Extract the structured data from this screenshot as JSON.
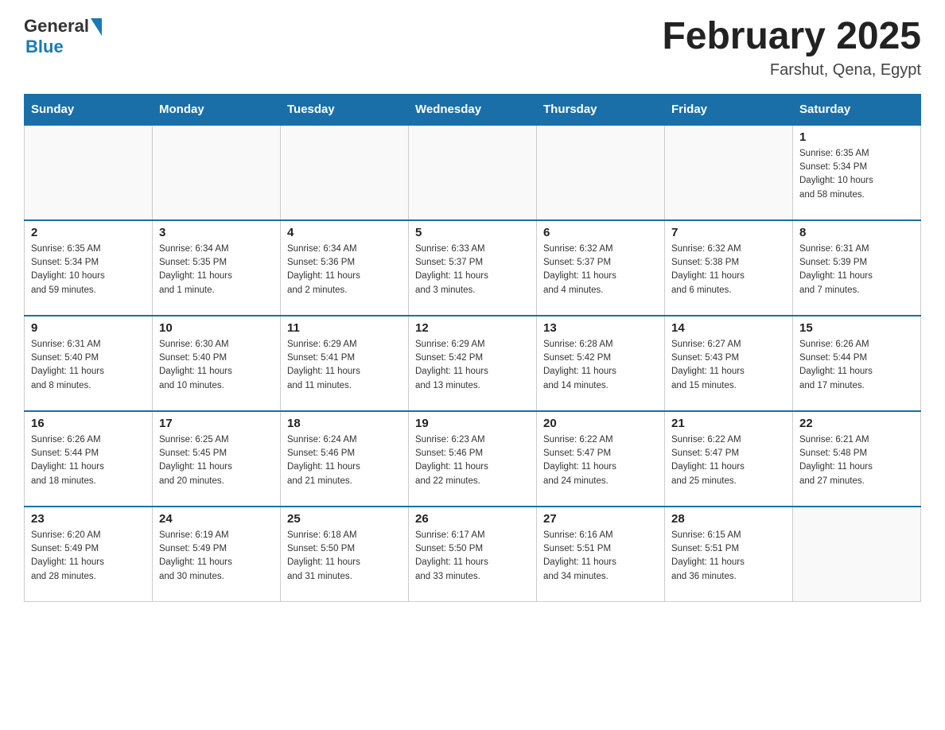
{
  "header": {
    "logo": {
      "general": "General",
      "blue": "Blue"
    },
    "title": "February 2025",
    "location": "Farshut, Qena, Egypt"
  },
  "weekdays": [
    "Sunday",
    "Monday",
    "Tuesday",
    "Wednesday",
    "Thursday",
    "Friday",
    "Saturday"
  ],
  "weeks": [
    [
      {
        "day": "",
        "info": ""
      },
      {
        "day": "",
        "info": ""
      },
      {
        "day": "",
        "info": ""
      },
      {
        "day": "",
        "info": ""
      },
      {
        "day": "",
        "info": ""
      },
      {
        "day": "",
        "info": ""
      },
      {
        "day": "1",
        "info": "Sunrise: 6:35 AM\nSunset: 5:34 PM\nDaylight: 10 hours\nand 58 minutes."
      }
    ],
    [
      {
        "day": "2",
        "info": "Sunrise: 6:35 AM\nSunset: 5:34 PM\nDaylight: 10 hours\nand 59 minutes."
      },
      {
        "day": "3",
        "info": "Sunrise: 6:34 AM\nSunset: 5:35 PM\nDaylight: 11 hours\nand 1 minute."
      },
      {
        "day": "4",
        "info": "Sunrise: 6:34 AM\nSunset: 5:36 PM\nDaylight: 11 hours\nand 2 minutes."
      },
      {
        "day": "5",
        "info": "Sunrise: 6:33 AM\nSunset: 5:37 PM\nDaylight: 11 hours\nand 3 minutes."
      },
      {
        "day": "6",
        "info": "Sunrise: 6:32 AM\nSunset: 5:37 PM\nDaylight: 11 hours\nand 4 minutes."
      },
      {
        "day": "7",
        "info": "Sunrise: 6:32 AM\nSunset: 5:38 PM\nDaylight: 11 hours\nand 6 minutes."
      },
      {
        "day": "8",
        "info": "Sunrise: 6:31 AM\nSunset: 5:39 PM\nDaylight: 11 hours\nand 7 minutes."
      }
    ],
    [
      {
        "day": "9",
        "info": "Sunrise: 6:31 AM\nSunset: 5:40 PM\nDaylight: 11 hours\nand 8 minutes."
      },
      {
        "day": "10",
        "info": "Sunrise: 6:30 AM\nSunset: 5:40 PM\nDaylight: 11 hours\nand 10 minutes."
      },
      {
        "day": "11",
        "info": "Sunrise: 6:29 AM\nSunset: 5:41 PM\nDaylight: 11 hours\nand 11 minutes."
      },
      {
        "day": "12",
        "info": "Sunrise: 6:29 AM\nSunset: 5:42 PM\nDaylight: 11 hours\nand 13 minutes."
      },
      {
        "day": "13",
        "info": "Sunrise: 6:28 AM\nSunset: 5:42 PM\nDaylight: 11 hours\nand 14 minutes."
      },
      {
        "day": "14",
        "info": "Sunrise: 6:27 AM\nSunset: 5:43 PM\nDaylight: 11 hours\nand 15 minutes."
      },
      {
        "day": "15",
        "info": "Sunrise: 6:26 AM\nSunset: 5:44 PM\nDaylight: 11 hours\nand 17 minutes."
      }
    ],
    [
      {
        "day": "16",
        "info": "Sunrise: 6:26 AM\nSunset: 5:44 PM\nDaylight: 11 hours\nand 18 minutes."
      },
      {
        "day": "17",
        "info": "Sunrise: 6:25 AM\nSunset: 5:45 PM\nDaylight: 11 hours\nand 20 minutes."
      },
      {
        "day": "18",
        "info": "Sunrise: 6:24 AM\nSunset: 5:46 PM\nDaylight: 11 hours\nand 21 minutes."
      },
      {
        "day": "19",
        "info": "Sunrise: 6:23 AM\nSunset: 5:46 PM\nDaylight: 11 hours\nand 22 minutes."
      },
      {
        "day": "20",
        "info": "Sunrise: 6:22 AM\nSunset: 5:47 PM\nDaylight: 11 hours\nand 24 minutes."
      },
      {
        "day": "21",
        "info": "Sunrise: 6:22 AM\nSunset: 5:47 PM\nDaylight: 11 hours\nand 25 minutes."
      },
      {
        "day": "22",
        "info": "Sunrise: 6:21 AM\nSunset: 5:48 PM\nDaylight: 11 hours\nand 27 minutes."
      }
    ],
    [
      {
        "day": "23",
        "info": "Sunrise: 6:20 AM\nSunset: 5:49 PM\nDaylight: 11 hours\nand 28 minutes."
      },
      {
        "day": "24",
        "info": "Sunrise: 6:19 AM\nSunset: 5:49 PM\nDaylight: 11 hours\nand 30 minutes."
      },
      {
        "day": "25",
        "info": "Sunrise: 6:18 AM\nSunset: 5:50 PM\nDaylight: 11 hours\nand 31 minutes."
      },
      {
        "day": "26",
        "info": "Sunrise: 6:17 AM\nSunset: 5:50 PM\nDaylight: 11 hours\nand 33 minutes."
      },
      {
        "day": "27",
        "info": "Sunrise: 6:16 AM\nSunset: 5:51 PM\nDaylight: 11 hours\nand 34 minutes."
      },
      {
        "day": "28",
        "info": "Sunrise: 6:15 AM\nSunset: 5:51 PM\nDaylight: 11 hours\nand 36 minutes."
      },
      {
        "day": "",
        "info": ""
      }
    ]
  ]
}
